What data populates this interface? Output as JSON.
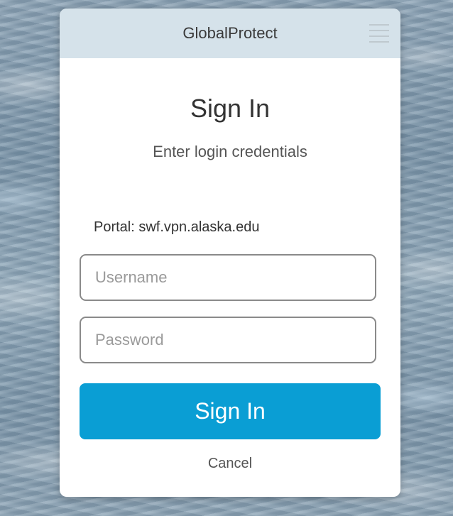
{
  "app": {
    "title": "GlobalProtect",
    "menu_icon": "hamburger-menu-icon"
  },
  "signin": {
    "heading": "Sign In",
    "subheading": "Enter login credentials",
    "portal": "Portal: swf.vpn.alaska.edu",
    "username": {
      "placeholder": "Username",
      "value": ""
    },
    "password": {
      "placeholder": "Password",
      "value": ""
    },
    "signin_button_label": "Sign In",
    "cancel_label": "Cancel"
  },
  "colors": {
    "titlebar": "#d5e2ea",
    "primary_button": "#0a9ed4",
    "panel_background": "#ffffff"
  }
}
